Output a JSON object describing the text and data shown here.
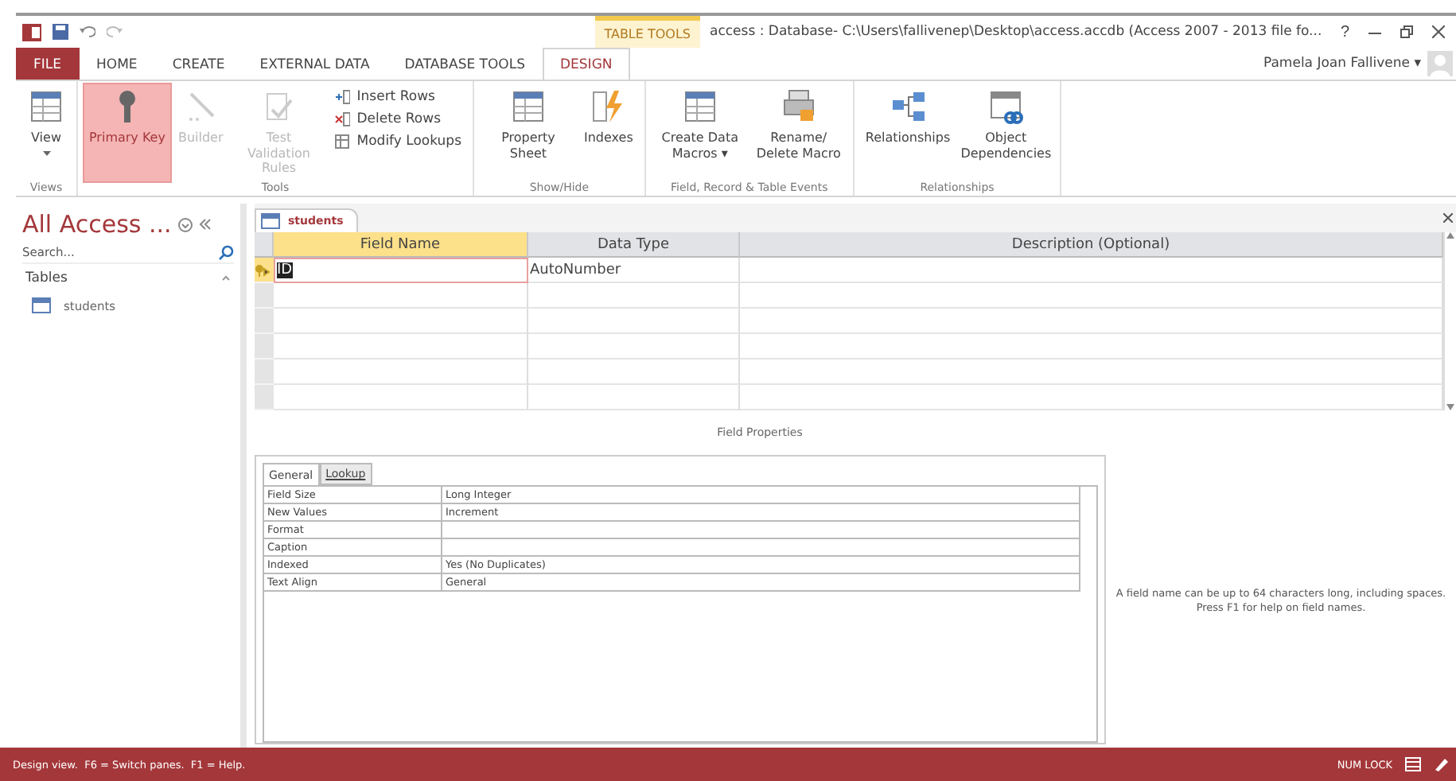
{
  "window": {
    "title": "access : Database- C:\\Users\\fallivenep\\Desktop\\access.accdb (Access 2007 - 2013 file fo...",
    "context_tab": "TABLE TOOLS",
    "user": "Pamela Joan Fallivene",
    "user_caret": "▾",
    "help": "?"
  },
  "ribbon_tabs": [
    {
      "label": "FILE",
      "kind": "file",
      "selected": false
    },
    {
      "label": "HOME",
      "kind": "tab",
      "selected": false
    },
    {
      "label": "CREATE",
      "kind": "tab",
      "selected": false
    },
    {
      "label": "EXTERNAL DATA",
      "kind": "tab",
      "selected": false
    },
    {
      "label": "DATABASE TOOLS",
      "kind": "tab",
      "selected": false
    },
    {
      "label": "DESIGN",
      "kind": "tab",
      "selected": true
    }
  ],
  "ribbon_groups": [
    {
      "name": "Views",
      "buttons": [
        {
          "label": "View",
          "kind": "large",
          "dropdown": true,
          "selected": false,
          "disabled": false
        }
      ]
    },
    {
      "name": "Tools",
      "buttons": [
        {
          "label": "Primary Key",
          "kind": "large",
          "dropdown": false,
          "selected": true,
          "disabled": false
        },
        {
          "label": "Builder",
          "kind": "large",
          "dropdown": false,
          "selected": false,
          "disabled": true
        },
        {
          "label": "Test Validation Rules",
          "kind": "large",
          "dropdown": false,
          "selected": false,
          "disabled": true
        },
        {
          "label": "Insert Rows",
          "kind": "small",
          "dropdown": false,
          "selected": false,
          "disabled": false
        },
        {
          "label": "Delete Rows",
          "kind": "small",
          "dropdown": false,
          "selected": false,
          "disabled": false
        },
        {
          "label": "Modify Lookups",
          "kind": "small",
          "dropdown": false,
          "selected": false,
          "disabled": false
        }
      ]
    },
    {
      "name": "Show/Hide",
      "buttons": [
        {
          "label": "Property Sheet",
          "kind": "large",
          "dropdown": false,
          "selected": false,
          "disabled": false
        },
        {
          "label": "Indexes",
          "kind": "large",
          "dropdown": false,
          "selected": false,
          "disabled": false
        }
      ]
    },
    {
      "name": "Field, Record & Table Events",
      "buttons": [
        {
          "label": "Create Data Macros ▾",
          "kind": "large",
          "dropdown": false,
          "selected": false,
          "disabled": false
        },
        {
          "label": "Rename/ Delete Macro",
          "kind": "large",
          "dropdown": false,
          "selected": false,
          "disabled": false
        }
      ]
    },
    {
      "name": "Relationships",
      "buttons": [
        {
          "label": "Relationships",
          "kind": "large",
          "dropdown": false,
          "selected": false,
          "disabled": false
        },
        {
          "label": "Object Dependencies",
          "kind": "large",
          "dropdown": false,
          "selected": false,
          "disabled": false
        }
      ]
    }
  ],
  "nav_pane": {
    "title": "All Access ...",
    "search": {
      "placeholder": "Search..."
    },
    "groups": [
      {
        "label": "Tables",
        "items": [
          {
            "label": "students",
            "selected": false
          }
        ]
      }
    ]
  },
  "document_tab": {
    "label": "students"
  },
  "design_grid": {
    "columns": [
      "Field Name",
      "Data Type",
      "Description (Optional)"
    ],
    "rows": [
      {
        "primary_key": true,
        "current": true,
        "field_name": "ID",
        "data_type": "AutoNumber"
      },
      {
        "primary_key": false,
        "current": false
      },
      {
        "primary_key": false,
        "current": false
      },
      {
        "primary_key": false,
        "current": false
      },
      {
        "primary_key": false,
        "current": false
      },
      {
        "primary_key": false,
        "current": false
      }
    ]
  },
  "field_properties": {
    "title": "Field Properties",
    "tabs": [
      {
        "label": "General",
        "selected": true
      },
      {
        "label": "Lookup",
        "selected": false
      }
    ],
    "rows": [
      {
        "name": "Field Size",
        "value": "Long Integer"
      },
      {
        "name": "New Values",
        "value": "Increment"
      },
      {
        "name": "Format"
      },
      {
        "name": "Caption"
      },
      {
        "name": "Indexed",
        "value": "Yes (No Duplicates)"
      },
      {
        "name": "Text Align",
        "value": "General"
      }
    ],
    "help": "A field name can be up to 64 characters long, including spaces. Press F1 for help on field names."
  },
  "status_bar": {
    "message": "Design view.  F6 = Switch panes.  F1 = Help.",
    "indicator": "NUM LOCK"
  }
}
